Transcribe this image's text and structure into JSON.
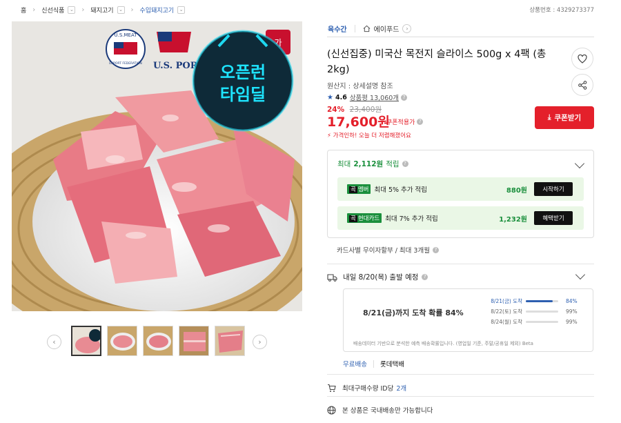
{
  "breadcrumb": {
    "items": [
      "홈",
      "신선식품",
      "돼지고기",
      "수입돼지고기"
    ],
    "dropdown_glyph": "⌄"
  },
  "product_number": "상품번호 : 4329273377",
  "image": {
    "logo_top_text": "U.S.MEAT",
    "logo_bottom_text": "EXPORT FEDERATION",
    "us_pork_text": "U.S. POR",
    "badge_line1": "오픈런",
    "badge_line2": "타임딜",
    "corner_tag": "가"
  },
  "thumbnails": {
    "count": 5,
    "selected_index": 0,
    "prev_icon": "chevron-left-icon",
    "next_icon": "chevron-right-icon"
  },
  "brand": {
    "category": "육수간",
    "store": "에이푸드",
    "store_icon": "home-icon"
  },
  "title": "(신선집중) 미국산 목전지 슬라이스 500g x 4팩 (총 2kg)",
  "origin": "원산지 : 상세설명 참조",
  "rating": {
    "score": "4.6",
    "review_label": "상품평 13,060개"
  },
  "pricing": {
    "discount": "24%",
    "original": "23,400원",
    "price": "17,600원",
    "coupon_note": "쿠폰적용가",
    "urgent": "가격인하! 오늘 더 저렴해졌어요"
  },
  "coupon_button": "쿠폰받기",
  "rewards": {
    "headline_prefix": "최대",
    "headline_amount": "2,112원",
    "headline_suffix": "적립",
    "rows": [
      {
        "tag_prefix": "곡",
        "tag": "멤버",
        "desc": "최대 5% 추가 적립",
        "amount": "880원",
        "action": "시작하기"
      },
      {
        "tag_prefix": "곡",
        "tag": "현대카드",
        "desc": "최대 7% 추가 적립",
        "amount": "1,232원",
        "action": "혜택받기"
      }
    ]
  },
  "installment": "카드사별 무이자할부 / 최대 3개월",
  "shipping": {
    "headline": "내일 8/20(목) 출발 예정",
    "probability_text": "8/21(금)까지 도착 확률 84%",
    "rows": [
      {
        "date": "8/21(금) 도착",
        "pct": "84%",
        "value": 0.84
      },
      {
        "date": "8/22(토) 도착",
        "pct": "99%",
        "value": 0
      },
      {
        "date": "8/24(월) 도착",
        "pct": "99%",
        "value": 0
      }
    ],
    "note": "배송데이터 기반으로 분석한 예측 배송확률입니다. (영업일 기준, 주말/공휴일 제외) Beta",
    "free_shipping": "무료배송",
    "carrier": "롯데택배"
  },
  "purchase_limit": {
    "label": "최대구매수량 ID당",
    "value": "2개"
  },
  "domestic_only": "본 상품은 국내배송만 가능합니다",
  "colors": {
    "accent_red": "#e4202b",
    "accent_blue": "#2d5fb0",
    "reward_green": "#1a8f3c"
  }
}
